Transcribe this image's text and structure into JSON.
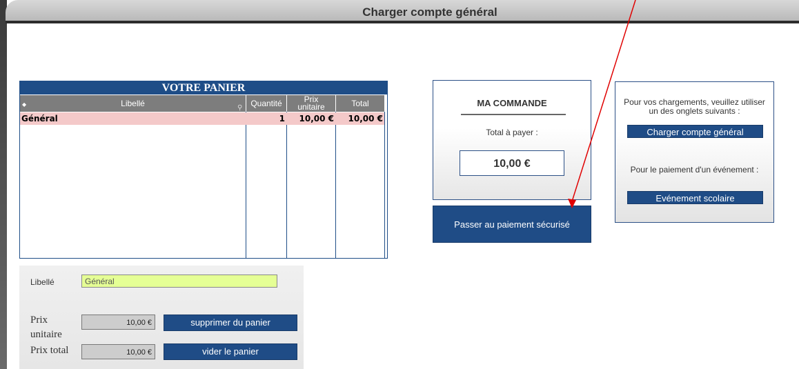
{
  "window": {
    "title": "Charger compte général"
  },
  "cart": {
    "title": "VOTRE PANIER",
    "columns": {
      "libelle": "Libellé",
      "quantite": "Quantité",
      "prix_line1": "Prix",
      "prix_line2": "unitaire",
      "total": "Total"
    },
    "rows": [
      {
        "libelle": "Général",
        "quantite": "1",
        "prix": "10,00 €",
        "total": "10,00 €"
      }
    ]
  },
  "form": {
    "libelle_label": "Libellé",
    "libelle_value": "Général",
    "prix_unitaire_label_1": "Prix",
    "prix_unitaire_label_2": "unitaire",
    "prix_unitaire_value": "10,00 €",
    "prix_total_label": "Prix total",
    "prix_total_value": "10,00 €",
    "remove_button": "supprimer du panier",
    "empty_button": "vider le panier"
  },
  "order": {
    "title": "MA COMMANDE",
    "total_label": "Total à payer :",
    "amount": "10,00 €",
    "pay_button": "Passer au paiement sécurisé"
  },
  "info": {
    "text1": "Pour vos chargements, veuillez utiliser un des onglets suivants :",
    "tab1": "Charger compte général",
    "text2": "Pour le paiement d'un événement :",
    "tab2": "Evénement scolaire"
  },
  "colors": {
    "primary": "#1f4c86",
    "row_highlight": "#f4c9c9",
    "field_highlight": "#e5ff95",
    "annotation_arrow": "#e00000"
  }
}
